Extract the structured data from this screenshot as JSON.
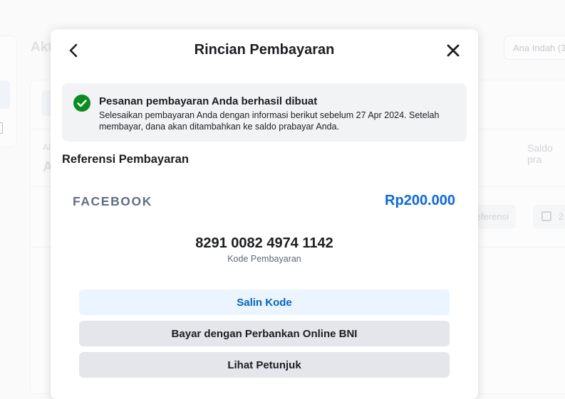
{
  "background": {
    "title": "Akt",
    "user_name": "Ana Indah (3",
    "col_label_left": "Ak",
    "value_left": "A",
    "saldo_label": "Saldo pra",
    "ref_filter": "eferensi",
    "date_filter": "2"
  },
  "modal": {
    "title": "Rincian Pembayaran",
    "back_icon": "chevron-left-icon",
    "close_icon": "close-icon",
    "success": {
      "icon": "check-circle-icon",
      "color": "#0a8d1f",
      "title": "Pesanan pembayaran Anda berhasil dibuat",
      "description": "Selesaikan pembayaran Anda dengan informasi berikut sebelum 27 Apr 2024. Setelah membayar, dana akan ditambahkan ke saldo prabayar Anda."
    },
    "reference": {
      "section_title": "Referensi Pembayaran",
      "brand": "FACEBOOK",
      "amount": "Rp200.000",
      "amount_color": "#0866ff",
      "payment_code": "8291 0082 4974 1142",
      "payment_code_label": "Kode Pembayaran"
    },
    "buttons": {
      "copy": "Salin Kode",
      "bank": "Bayar dengan Perbankan Online BNI",
      "guide": "Lihat Petunjuk"
    }
  }
}
